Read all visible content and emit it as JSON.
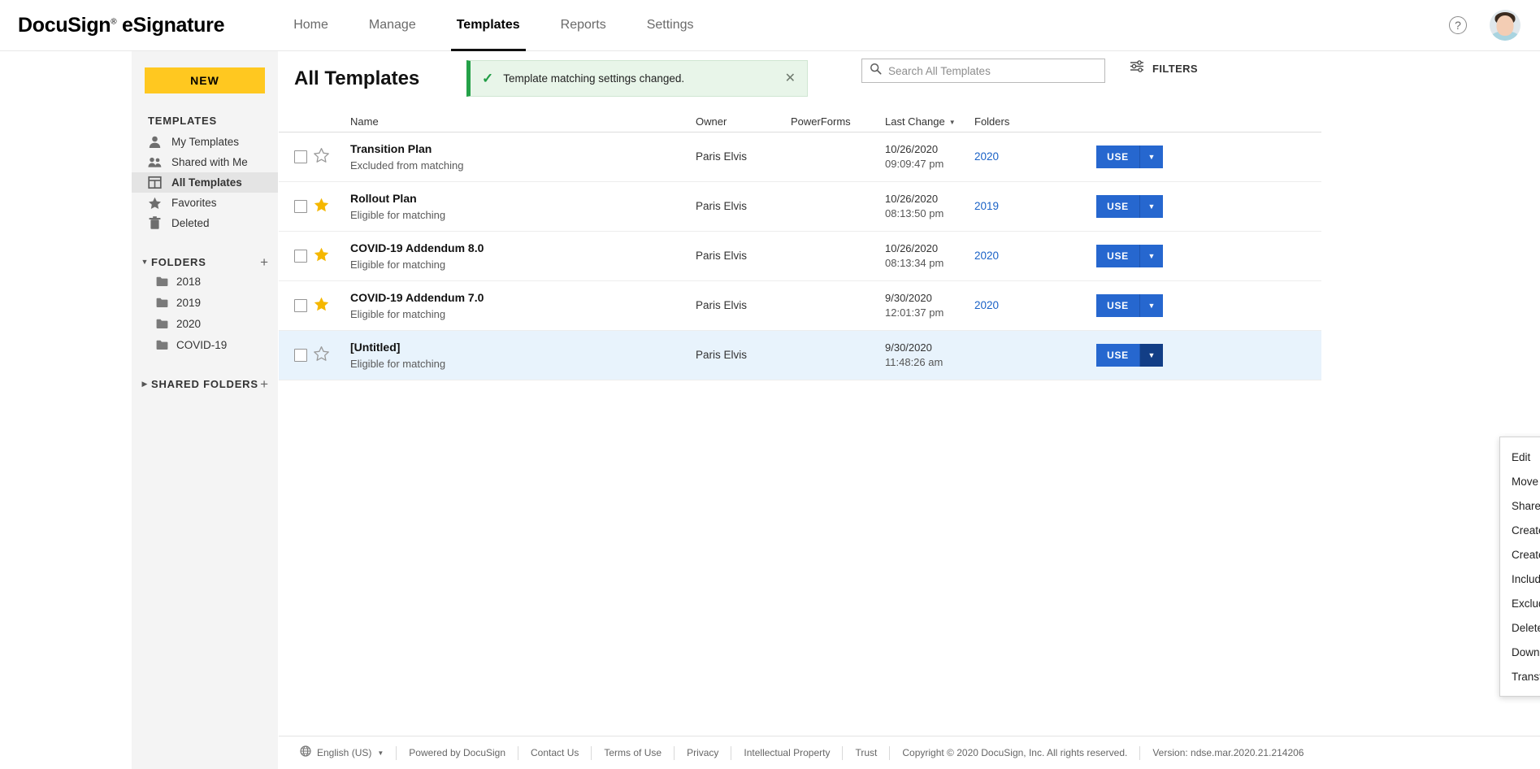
{
  "topnav": {
    "brand": "DocuSign eSignature",
    "brand_tm": "®",
    "items": [
      {
        "label": "Home",
        "active": false
      },
      {
        "label": "Manage",
        "active": false
      },
      {
        "label": "Templates",
        "active": true
      },
      {
        "label": "Reports",
        "active": false
      },
      {
        "label": "Settings",
        "active": false
      }
    ],
    "help_icon": "question-mark-icon",
    "help_glyph": "?",
    "avatar": "user-avatar"
  },
  "sidebar": {
    "new_button": "NEW",
    "templates_heading": "TEMPLATES",
    "items": [
      {
        "label": "My Templates",
        "icon": "person-icon",
        "active": false
      },
      {
        "label": "Shared with Me",
        "icon": "people-icon",
        "active": false
      },
      {
        "label": "All Templates",
        "icon": "grid-icon",
        "active": true
      },
      {
        "label": "Favorites",
        "icon": "star-icon",
        "active": false
      },
      {
        "label": "Deleted",
        "icon": "trash-icon",
        "active": false
      }
    ],
    "folders_heading": "FOLDERS",
    "folders_caret": "▼",
    "folders_add": "+",
    "folders": [
      {
        "label": "2018"
      },
      {
        "label": "2019"
      },
      {
        "label": "2020"
      },
      {
        "label": "COVID-19"
      }
    ],
    "shared_heading": "SHARED FOLDERS",
    "shared_caret": "▶",
    "shared_add": "+"
  },
  "main": {
    "page_title": "All Templates",
    "banner": {
      "text": "Template matching settings changed.",
      "check_glyph": "✓",
      "close_glyph": "✕",
      "accent_color": "#24a148",
      "background_color": "#e8f5e9"
    },
    "search": {
      "placeholder": "Search All Templates",
      "value": "",
      "icon": "search-icon"
    },
    "filters": {
      "label": "FILTERS",
      "icon": "filters-sliders-icon"
    },
    "table": {
      "columns": {
        "name": "Name",
        "owner": "Owner",
        "powerforms": "PowerForms",
        "last_change": "Last Change",
        "folders": "Folders"
      },
      "sort_column": "Last Change",
      "sort_caret": "▼",
      "rows": [
        {
          "name": "Transition Plan",
          "matching": "Excluded from matching",
          "favorite": false,
          "owner": "Paris Elvis",
          "powerforms": "",
          "date": "10/26/2020",
          "time": "09:09:47 pm",
          "folder": "2020",
          "use_label": "USE",
          "selected": false,
          "menu_open": false
        },
        {
          "name": "Rollout Plan",
          "matching": "Eligible for matching",
          "favorite": true,
          "owner": "Paris Elvis",
          "powerforms": "",
          "date": "10/26/2020",
          "time": "08:13:50 pm",
          "folder": "2019",
          "use_label": "USE",
          "selected": false,
          "menu_open": false
        },
        {
          "name": "COVID-19 Addendum 8.0",
          "matching": "Eligible for matching",
          "favorite": true,
          "owner": "Paris Elvis",
          "powerforms": "",
          "date": "10/26/2020",
          "time": "08:13:34 pm",
          "folder": "2020",
          "use_label": "USE",
          "selected": false,
          "menu_open": false
        },
        {
          "name": "COVID-19 Addendum 7.0",
          "matching": "Eligible for matching",
          "favorite": true,
          "owner": "Paris Elvis",
          "powerforms": "",
          "date": "9/30/2020",
          "time": "12:01:37 pm",
          "folder": "2020",
          "use_label": "USE",
          "selected": false,
          "menu_open": false
        },
        {
          "name": "[Untitled]",
          "matching": "Eligible for matching",
          "favorite": false,
          "owner": "Paris Elvis",
          "powerforms": "",
          "date": "9/30/2020",
          "time": "11:48:26 am",
          "folder": "",
          "use_label": "USE",
          "selected": true,
          "menu_open": true
        }
      ]
    },
    "context_menu": [
      {
        "label": "Edit"
      },
      {
        "label": "Move"
      },
      {
        "label": "Share to Folders"
      },
      {
        "label": "Create a Copy"
      },
      {
        "label": "Create PowerForm"
      },
      {
        "label": "Include in Matching"
      },
      {
        "label": "Exclude from Matching"
      },
      {
        "label": "Delete"
      },
      {
        "label": "Download"
      },
      {
        "label": "Transfer Ownership"
      }
    ]
  },
  "footer": {
    "language": "English (US)",
    "language_caret": "▼",
    "links": [
      "Powered by DocuSign",
      "Contact Us",
      "Terms of Use",
      "Privacy",
      "Intellectual Property",
      "Trust"
    ],
    "copyright": "Copyright © 2020 DocuSign, Inc. All rights reserved.",
    "version": "Version: ndse.mar.2020.21.214206"
  },
  "colors": {
    "brand_yellow": "#ffc820",
    "primary_blue": "#2667cf",
    "link_blue": "#1b62c6",
    "selected_row": "#e8f3fc",
    "star_gold": "#f5b700"
  }
}
